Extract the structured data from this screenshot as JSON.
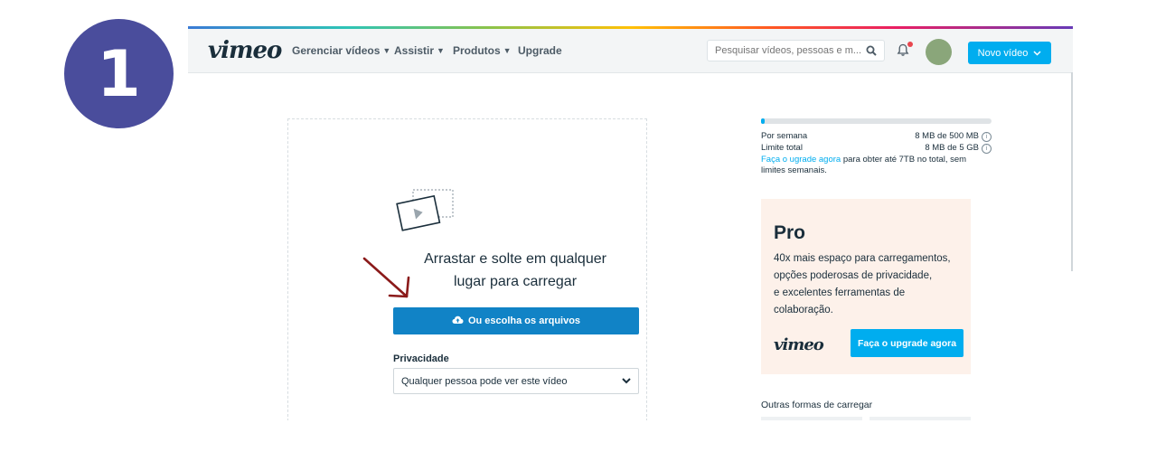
{
  "step_number": "1",
  "header": {
    "logo": "vimeo",
    "nav": [
      "Gerenciar vídeos",
      "Assistir",
      "Produtos",
      "Upgrade"
    ],
    "search_placeholder": "Pesquisar vídeos, pessoas e m...",
    "new_video_label": "Novo vídeo"
  },
  "upload": {
    "drop_line1": "Arrastar e solte em qualquer",
    "drop_line2": "lugar para carregar",
    "choose_button": "Ou escolha os arquivos",
    "privacy_label": "Privacidade",
    "privacy_value": "Qualquer pessoa pode ver este vídeo"
  },
  "quota": {
    "weekly_label": "Por semana",
    "weekly_value": "8 MB de 500 MB",
    "total_label": "Limite total",
    "total_value": "8 MB de 5 GB",
    "weekly_usage_fraction": 0.016,
    "upgrade_link": "Faça o ugrade agora",
    "upgrade_rest": " para obter até 7TB no total, sem limites semanais."
  },
  "pro_card": {
    "title": "Pro",
    "desc_line1": "40x mais espaço para carregamentos,",
    "desc_line2": "opções poderosas de privacidade,",
    "desc_line3": "e excelentes ferramentas de",
    "desc_line4": "colaboração.",
    "logo": "vimeo",
    "button": "Faça o upgrade agora"
  },
  "other_uploads_label": "Outras formas de carregar",
  "colors": {
    "accent": "#00adef",
    "choose_button": "#1183c6",
    "badge": "#4a4d9c",
    "arrow": "#8b1a1a",
    "pro_bg": "#fdf1ea"
  },
  "icons": [
    "chevron-down-icon",
    "search-icon",
    "bell-icon",
    "cloud-upload-icon",
    "video-placeholder-icon",
    "info-icon",
    "red-arrow-annotation"
  ]
}
